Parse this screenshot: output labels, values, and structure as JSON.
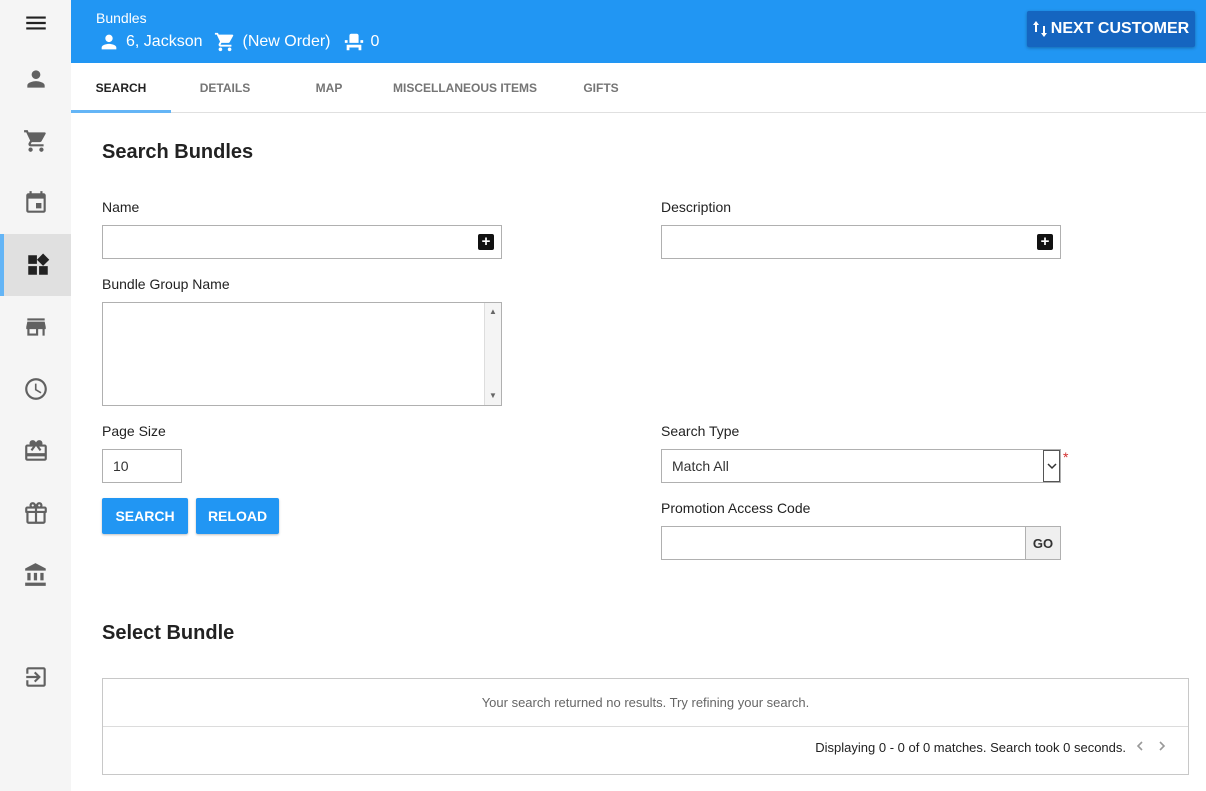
{
  "header": {
    "title": "Bundles",
    "customer": "6, Jackson",
    "order": "(New Order)",
    "seat_count": "0",
    "next_customer_label": "NEXT CUSTOMER"
  },
  "sidebar": {
    "items": [
      {
        "name": "customer",
        "icon": "person-icon"
      },
      {
        "name": "cart",
        "icon": "cart-icon"
      },
      {
        "name": "calendar",
        "icon": "calendar-icon"
      },
      {
        "name": "bundles",
        "icon": "widgets-icon",
        "active": true
      },
      {
        "name": "store",
        "icon": "store-icon"
      },
      {
        "name": "history",
        "icon": "clock-icon"
      },
      {
        "name": "tickets",
        "icon": "ticket-icon"
      },
      {
        "name": "gifts",
        "icon": "gift-icon"
      },
      {
        "name": "bank",
        "icon": "bank-icon"
      },
      {
        "name": "logout",
        "icon": "logout-icon"
      }
    ]
  },
  "tabs": [
    "SEARCH",
    "DETAILS",
    "MAP",
    "MISCELLANEOUS ITEMS",
    "GIFTS"
  ],
  "search": {
    "heading": "Search Bundles",
    "name_label": "Name",
    "name_value": "",
    "description_label": "Description",
    "description_value": "",
    "bundle_group_label": "Bundle Group Name",
    "page_size_label": "Page Size",
    "page_size_value": "10",
    "search_type_label": "Search Type",
    "search_type_value": "Match All",
    "required_mark": "*",
    "promo_label": "Promotion Access Code",
    "promo_value": "",
    "go_label": "GO",
    "search_button": "SEARCH",
    "reload_button": "RELOAD"
  },
  "results": {
    "heading": "Select Bundle",
    "empty_message": "Your search returned no results. Try refining your search.",
    "footer": "Displaying 0 - 0 of 0 matches. Search took 0 seconds."
  },
  "colors": {
    "accent": "#2196f3",
    "accent_dark": "#1565c0",
    "sidebar_bg": "#f5f5f5",
    "required": "#d32f2f"
  }
}
